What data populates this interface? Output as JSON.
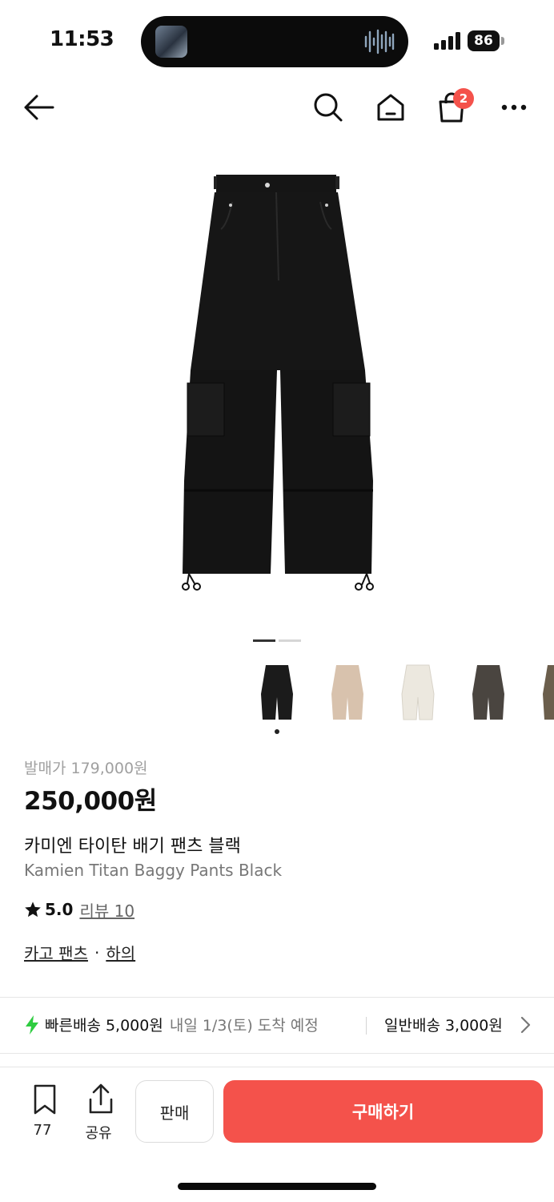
{
  "status_bar": {
    "time": "11:53",
    "battery": "86"
  },
  "nav": {
    "cart_count": "2",
    "icons": [
      "back-arrow-icon",
      "search-icon",
      "home-icon",
      "bag-icon",
      "more-icon"
    ]
  },
  "gallery": {
    "current_page": 1,
    "total_pages": 2,
    "thumbnail_colors": [
      "#1b1b1b",
      "#d8c2ad",
      "#ece8df",
      "#4a4540",
      "#6b5e4c"
    ]
  },
  "product": {
    "release_price": "발매가 179,000원",
    "price": "250,000원",
    "name_ko": "카미엔 타이탄 배기 팬츠 블랙",
    "name_en": "Kamien Titan Baggy Pants Black",
    "rating": "5.0",
    "review_label": "리뷰 10",
    "categories": [
      "카고 팬츠",
      "하의"
    ],
    "category_separator": "·"
  },
  "shipping": {
    "fast_label": "빠른배송 5,000원",
    "fast_eta": "내일 1/3(토) 도착 예정",
    "normal_label": "일반배송 3,000원",
    "accent_color": "#2ecc40"
  },
  "bottom_bar": {
    "bookmark_count": "77",
    "share_label": "공유",
    "sell_label": "판매",
    "buy_label": "구매하기",
    "buy_color": "#f4524b"
  }
}
